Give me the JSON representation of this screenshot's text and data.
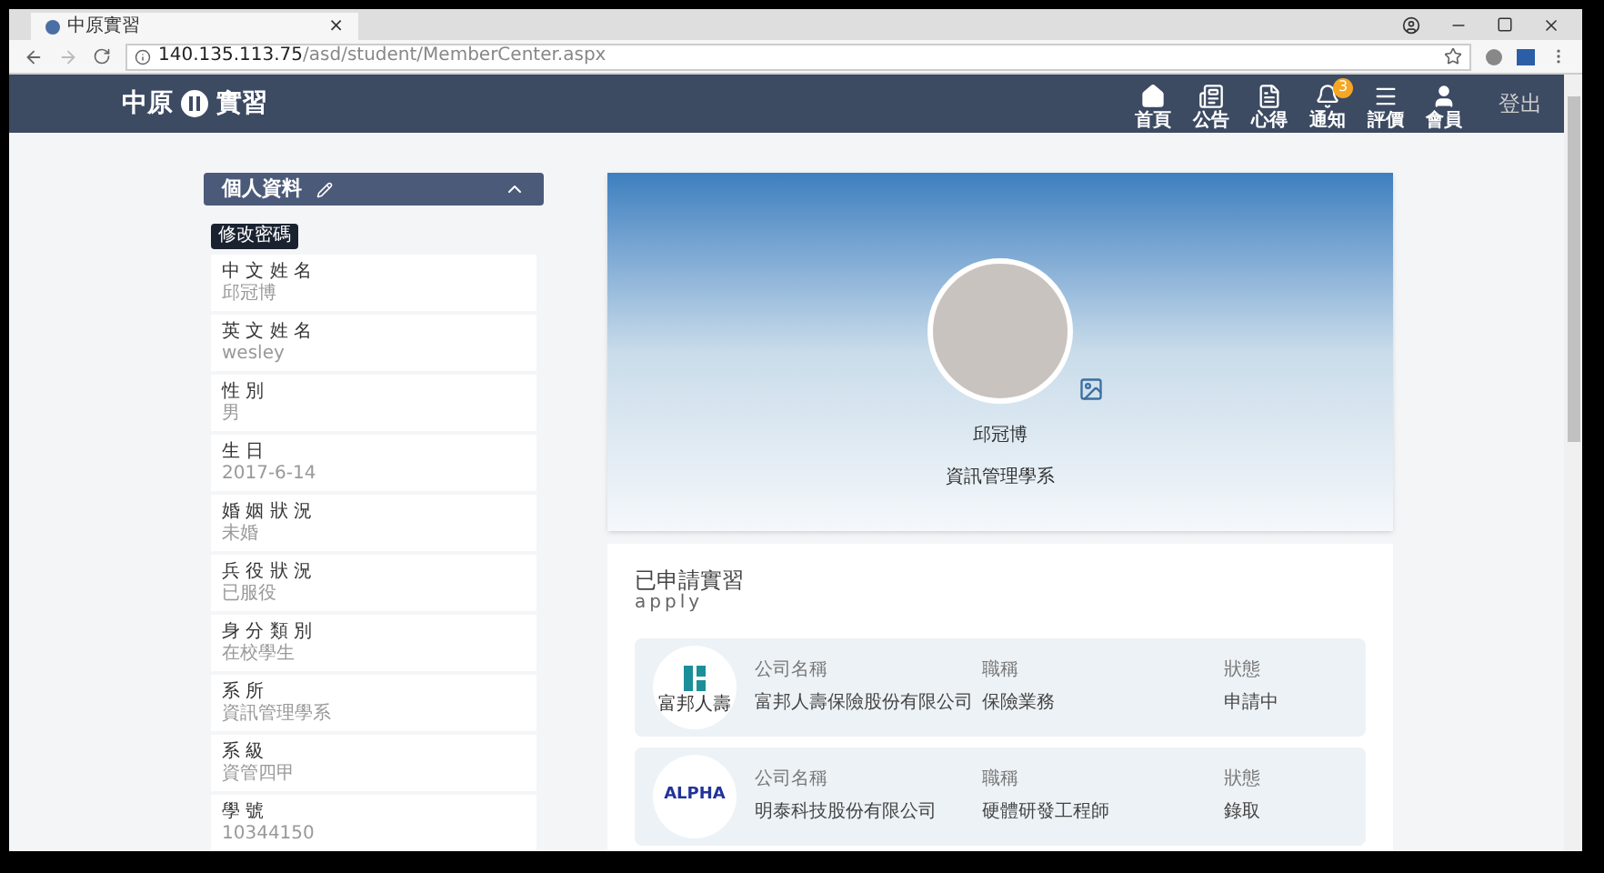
{
  "browser": {
    "tab_title": "中原實習",
    "tab_close": "×",
    "url_host": "140.135.113.75",
    "url_path": "/asd/student/MemberCenter.aspx"
  },
  "navbar": {
    "logo_left": "中原",
    "logo_right": "實習",
    "items": [
      {
        "kind": "home",
        "label": "首頁"
      },
      {
        "kind": "news",
        "label": "公告"
      },
      {
        "kind": "doc",
        "label": "心得"
      },
      {
        "kind": "bell",
        "label": "通知",
        "badge": "3"
      },
      {
        "kind": "menu",
        "label": "評價"
      },
      {
        "kind": "user",
        "label": "會員"
      }
    ],
    "logout": "登出"
  },
  "profile_panel": {
    "title": "個人資料",
    "expanded": true,
    "tooltip": "修改密碼",
    "fields": [
      {
        "label": "中 文 姓 名",
        "value": "邱冠博"
      },
      {
        "label": "英 文 姓 名",
        "value": "wesley"
      },
      {
        "label": "性 別",
        "value": "男"
      },
      {
        "label": "生 日",
        "value": "2017-6-14"
      },
      {
        "label": "婚 姻 狀 況",
        "value": "未婚"
      },
      {
        "label": "兵 役 狀 況",
        "value": "已服役"
      },
      {
        "label": "身 分 類 別",
        "value": "在校學生"
      },
      {
        "label": "系 所",
        "value": "資訊管理學系"
      },
      {
        "label": "系 級",
        "value": "資管四甲"
      },
      {
        "label": "學 號",
        "value": "10344150"
      }
    ]
  },
  "profile_card": {
    "name": "邱冠博",
    "department": "資訊管理學系"
  },
  "applications": {
    "title": "已申請實習",
    "subtitle": "apply",
    "rows": [
      {
        "kind": "mark_logo",
        "logo_text": "富邦人壽",
        "labels": [
          "公司名稱",
          "職稱",
          "狀態"
        ],
        "company": "富邦人壽保險股份有限公司",
        "position": "保險業務",
        "status": "申請中"
      },
      {
        "kind": "text_logo",
        "logo_text": "ALPHA",
        "labels": [
          "公司名稱",
          "職稱",
          "狀態"
        ],
        "company": "明泰科技股份有限公司",
        "position": "硬體研發工程師",
        "status": "錄取"
      }
    ]
  }
}
